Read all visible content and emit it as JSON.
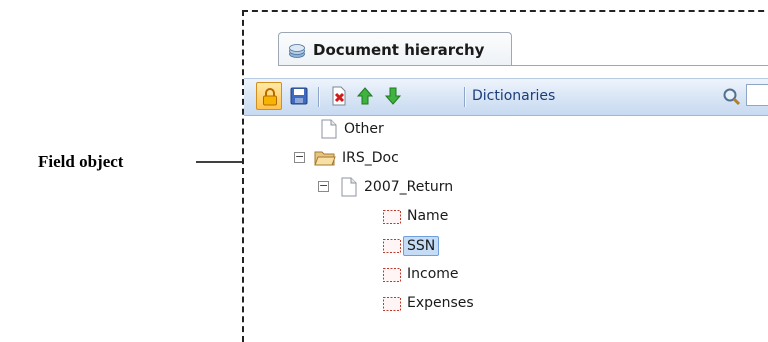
{
  "callout": {
    "label": "Field object"
  },
  "panel": {
    "tab": {
      "label": "Document hierarchy",
      "icon": "stack-icon"
    },
    "toolbar": {
      "buttons": [
        {
          "name": "lock-button",
          "icon": "lock-icon",
          "active": true
        },
        {
          "name": "save-button",
          "icon": "save-icon"
        },
        {
          "name": "delete-button",
          "icon": "delete-icon"
        },
        {
          "name": "move-up-button",
          "icon": "arrow-up-icon"
        },
        {
          "name": "move-down-button",
          "icon": "arrow-down-icon"
        }
      ],
      "dictionaries_label": "Dictionaries",
      "search": {
        "value": "",
        "placeholder": ""
      }
    },
    "tree": {
      "items": [
        {
          "label": "Other",
          "type": "document"
        },
        {
          "label": "IRS_Doc",
          "type": "folder",
          "expanded": true
        },
        {
          "label": "2007_Return",
          "type": "document",
          "expanded": true
        },
        {
          "label": "Name",
          "type": "field"
        },
        {
          "label": "SSN",
          "type": "field",
          "selected": true
        },
        {
          "label": "Income",
          "type": "field"
        },
        {
          "label": "Expenses",
          "type": "field"
        }
      ]
    }
  },
  "colors": {
    "toolbar_top": "#eef4fc",
    "toolbar_bottom": "#c8daf1",
    "selection_fill": "#c5dcf7",
    "selection_border": "#6f9edb",
    "active_button": "#ffc24d"
  }
}
